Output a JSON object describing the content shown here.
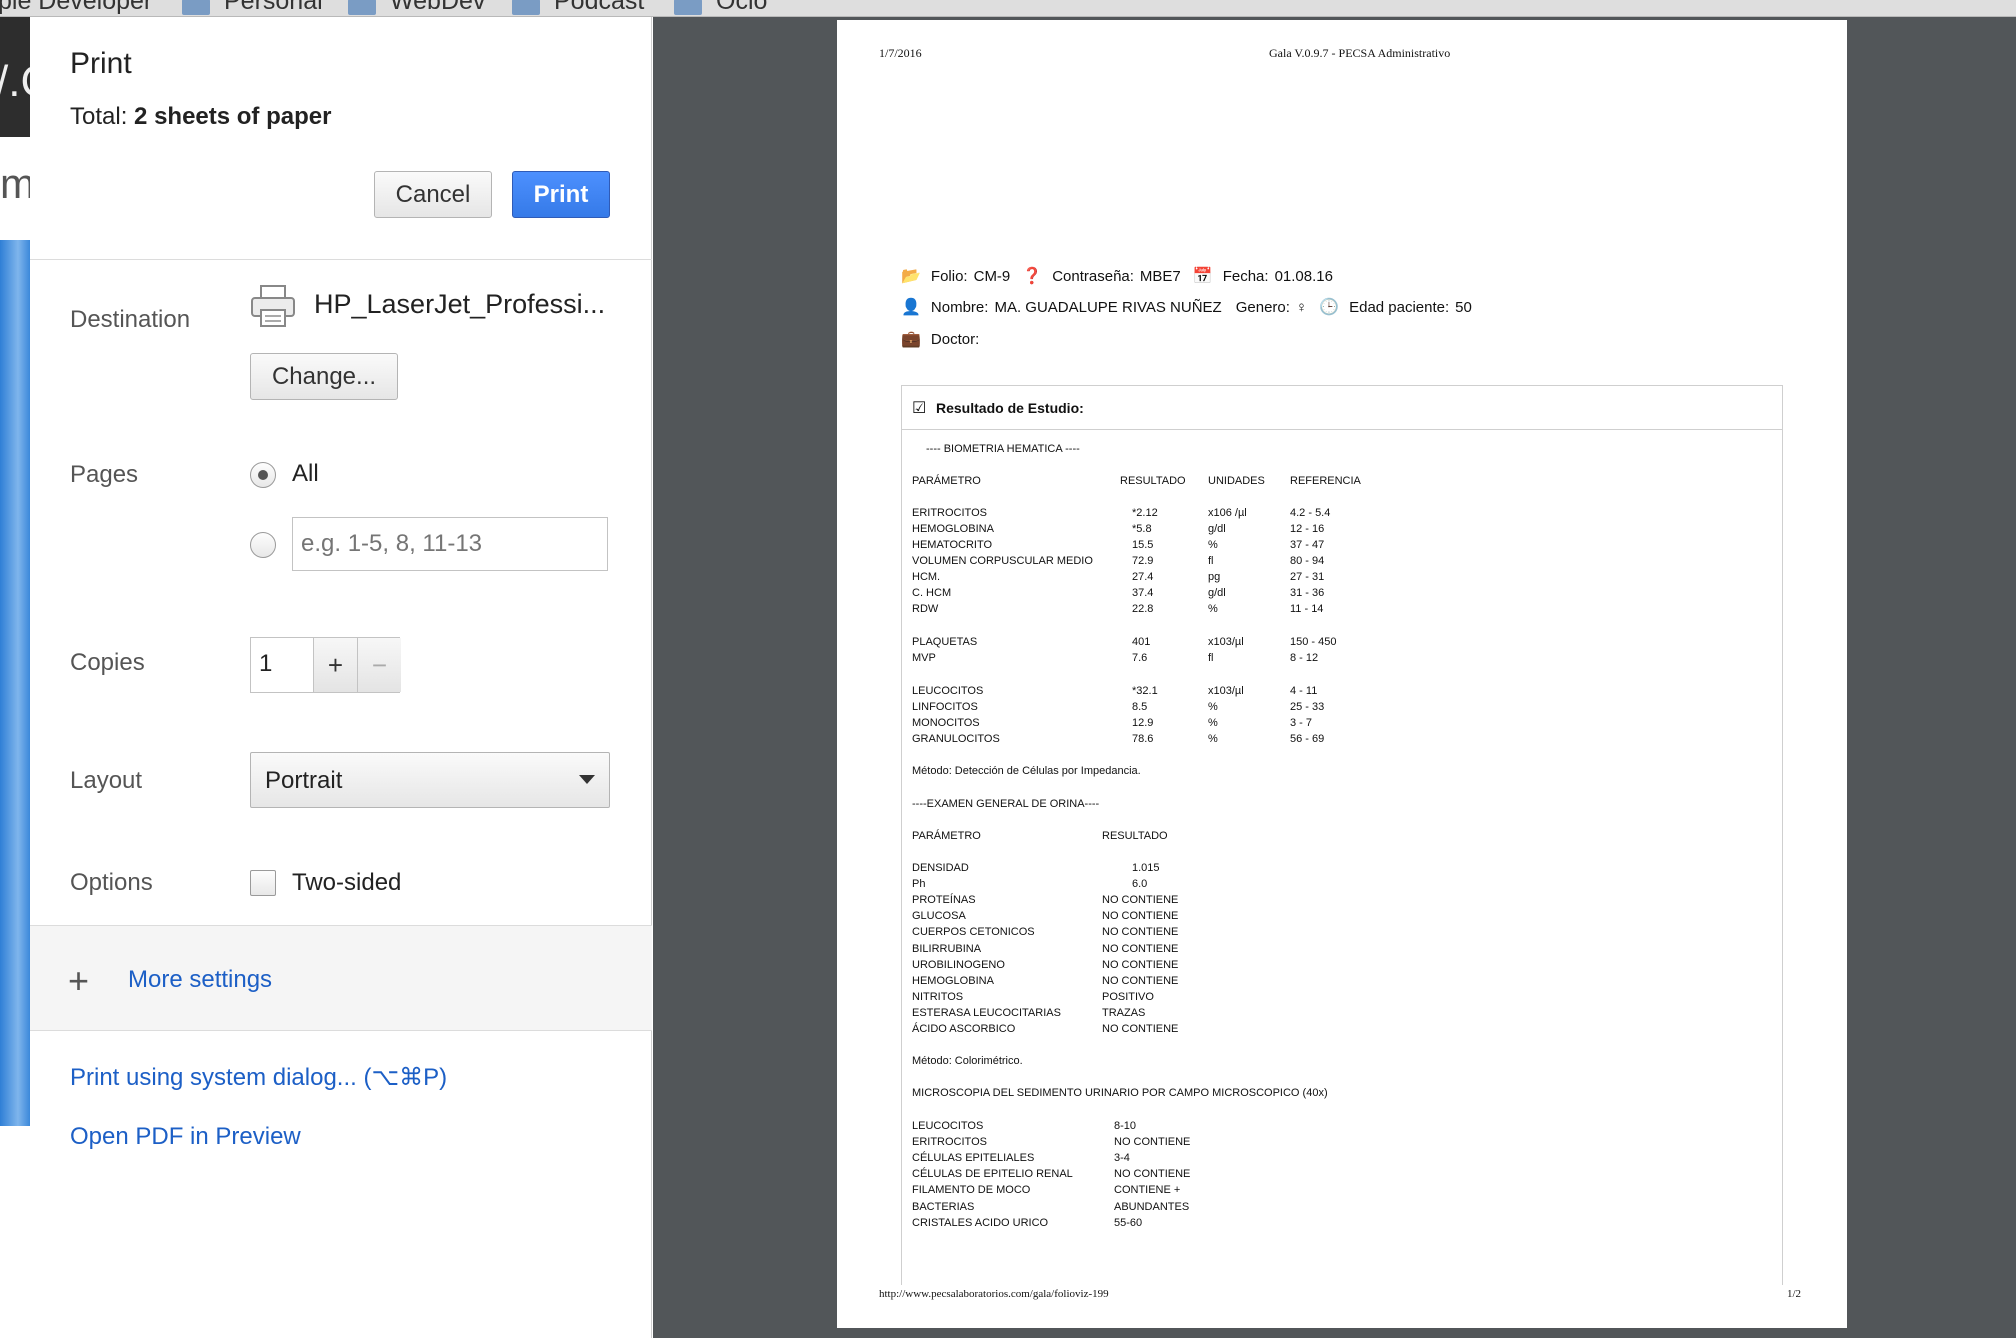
{
  "bookmarks": [
    {
      "label": "ple Developer"
    },
    {
      "label": "Personal"
    },
    {
      "label": "WebDev"
    },
    {
      "label": "Podcast"
    },
    {
      "label": "Ocio"
    }
  ],
  "background_page": {
    "dark_text": "/.C",
    "m_text": "m"
  },
  "dialog": {
    "title": "Print",
    "total_label": "Total:",
    "total_value": "2 sheets of paper",
    "cancel": "Cancel",
    "print": "Print",
    "destination_label": "Destination",
    "destination_name": "HP_LaserJet_Professi...",
    "change": "Change...",
    "pages_label": "Pages",
    "pages_all": "All",
    "pages_placeholder": "e.g. 1-5, 8, 11-13",
    "copies_label": "Copies",
    "copies_value": "1",
    "copies_plus": "+",
    "copies_minus": "−",
    "layout_label": "Layout",
    "layout_value": "Portrait",
    "options_label": "Options",
    "two_sided": "Two-sided",
    "more_settings": "More settings",
    "system_dialog": "Print using system dialog... (⌥⌘P)",
    "open_pdf": "Open PDF in Preview"
  },
  "document": {
    "header_date": "1/7/2016",
    "header_title": "Gala V.0.9.7 - PECSA Administrativo",
    "folio_label": "Folio:",
    "folio": "CM-9",
    "contrasena_label": "Contraseña:",
    "contrasena": "MBE7",
    "fecha_label": "Fecha:",
    "fecha": "01.08.16",
    "nombre_label": "Nombre:",
    "nombre": "MA. GUADALUPE RIVAS NUÑEZ",
    "genero_label": "Genero:",
    "genero": "♀",
    "edad_label": "Edad paciente:",
    "edad": "50",
    "doctor_label": "Doctor:",
    "result_title": "Resultado de Estudio:",
    "biometria_title": "---- BIOMETRIA HEMATICA ----",
    "bh_headers": [
      "PARÁMETRO",
      "RESULTADO",
      "UNIDADES",
      "REFERENCIA"
    ],
    "bh_rows": [
      [
        "ERITROCITOS",
        "*2.12",
        "x106 /µl",
        "4.2 - 5.4"
      ],
      [
        "HEMOGLOBINA",
        "*5.8",
        "g/dl",
        "12 - 16"
      ],
      [
        "HEMATOCRITO",
        "15.5",
        "%",
        "37 - 47"
      ],
      [
        "VOLUMEN CORPUSCULAR MEDIO",
        "72.9",
        "fl",
        "80 - 94"
      ],
      [
        "HCM.",
        "27.4",
        "pg",
        "27 - 31"
      ],
      [
        "C. HCM",
        "37.4",
        "g/dl",
        "31 - 36"
      ],
      [
        "RDW",
        "22.8",
        "%",
        "11 - 14"
      ],
      [
        "PLAQUETAS",
        "401",
        "x103/µl",
        "150 - 450"
      ],
      [
        "MVP",
        "7.6",
        "fl",
        "8 - 12"
      ],
      [
        "LEUCOCITOS",
        "*32.1",
        "x103/µl",
        "4 - 11"
      ],
      [
        "LINFOCITOS",
        "8.5",
        "%",
        "25 - 33"
      ],
      [
        "MONOCITOS",
        "12.9",
        "%",
        "3 - 7"
      ],
      [
        "GRANULOCITOS",
        "78.6",
        "%",
        "56 - 69"
      ]
    ],
    "metodo_bh": "Método: Detección de Células por Impedancia.",
    "orina_title": "----EXAMEN GENERAL DE ORINA----",
    "eo_headers": [
      "PARÁMETRO",
      "RESULTADO"
    ],
    "eo_rows": [
      [
        "DENSIDAD",
        "1.015"
      ],
      [
        "Ph",
        "6.0"
      ],
      [
        "PROTEÍNAS",
        "NO CONTIENE"
      ],
      [
        "GLUCOSA",
        "NO CONTIENE"
      ],
      [
        "CUERPOS CETONICOS",
        "NO CONTIENE"
      ],
      [
        "BILIRRUBINA",
        "NO CONTIENE"
      ],
      [
        "UROBILINOGENO",
        "NO CONTIENE"
      ],
      [
        "HEMOGLOBINA",
        "NO CONTIENE"
      ],
      [
        "NITRITOS",
        "POSITIVO"
      ],
      [
        "ESTERASA LEUCOCITARIAS",
        "TRAZAS"
      ],
      [
        "ÁCIDO ASCORBICO",
        "NO CONTIENE"
      ]
    ],
    "metodo_eo": "Método: Colorimétrico.",
    "micro_title": "MICROSCOPIA DEL SEDIMENTO URINARIO POR CAMPO MICROSCOPICO (40x)",
    "micro_rows": [
      [
        "LEUCOCITOS",
        "8-10"
      ],
      [
        "ERITROCITOS",
        "NO CONTIENE"
      ],
      [
        "CÉLULAS EPITELIALES",
        "3-4"
      ],
      [
        "CÉLULAS DE EPITELIO RENAL",
        "NO CONTIENE"
      ],
      [
        "FILAMENTO DE MOCO",
        "CONTIENE +"
      ],
      [
        "BACTERIAS",
        "ABUNDANTES"
      ],
      [
        "CRISTALES ACIDO URICO",
        "55-60"
      ]
    ],
    "footer_url": "http://www.pecsalaboratorios.com/gala/folioviz-199",
    "footer_page": "1/2"
  },
  "colors": {
    "accent": "#4d90fe",
    "link": "#1c5fc6",
    "preview_bg": "#525659"
  }
}
